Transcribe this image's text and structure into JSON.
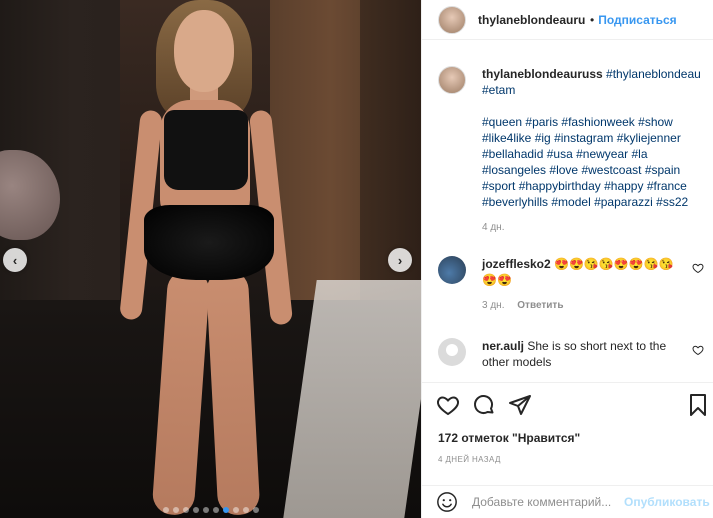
{
  "header": {
    "username": "thylaneblondeauru",
    "separator": "•",
    "follow_label": "Подписаться"
  },
  "caption": {
    "username": "thylaneblondeauruss",
    "tags_line1": "#thylaneblondeau",
    "tags_line2": "#etam",
    "hashtags": [
      "#queen",
      "#paris",
      "#fashionweek",
      "#show",
      "#like4like",
      "#ig",
      "#instagram",
      "#kyliejenner",
      "#bellahadid",
      "#usa",
      "#newyear",
      "#la",
      "#losangeles",
      "#love",
      "#westcoast",
      "#spain",
      "#sport",
      "#happybirthday",
      "#happy",
      "#france",
      "#beverlyhills",
      "#model",
      "#paparazzi",
      "#ss22"
    ],
    "time": "4 дн."
  },
  "comments": [
    {
      "username": "jozefflesko2",
      "text": "😍😍😘😘😍😍😘😘😍😍",
      "time": "3 дн.",
      "reply_label": "Ответить"
    },
    {
      "username": "ner.aulj",
      "text": "She is so short next to the other models"
    }
  ],
  "likes": "172 отметок \"Нравится\"",
  "posted": "4 ДНЕЙ НАЗАД",
  "comment_box": {
    "placeholder": "Добавьте комментарий...",
    "publish_label": "Опубликовать"
  },
  "carousel": {
    "total": 10,
    "active_index": 6,
    "prev_icon": "‹",
    "next_icon": "›"
  },
  "colors": {
    "accent": "#3897f0",
    "publish_disabled": "#b2dffc",
    "meta_gray": "#8e8e8e"
  }
}
